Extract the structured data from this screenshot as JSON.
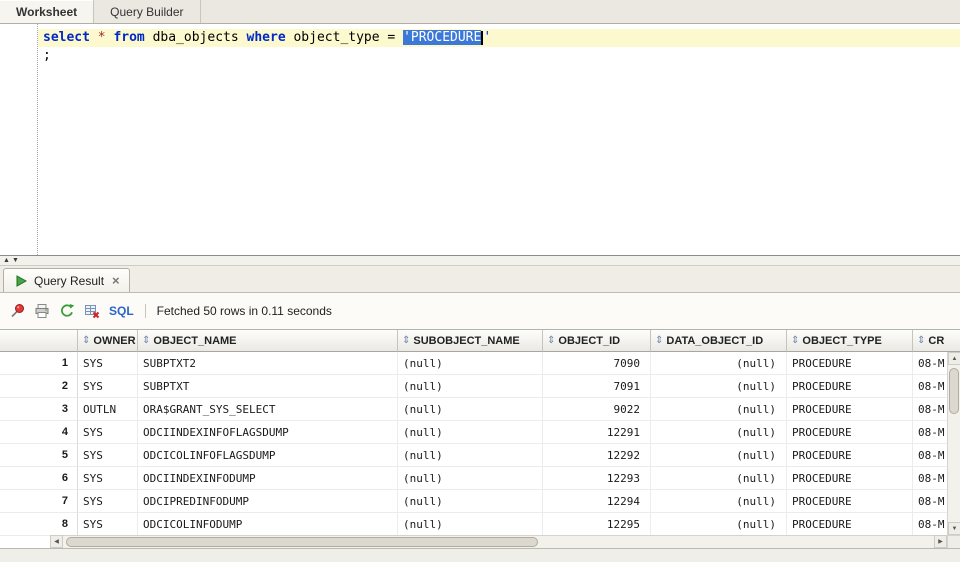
{
  "tabs": [
    {
      "label": "Worksheet"
    },
    {
      "label": "Query Builder"
    }
  ],
  "editor": {
    "lines": [
      {
        "tokens": [
          {
            "text": "select",
            "type": "kw"
          },
          {
            "text": " ",
            "type": "pl"
          },
          {
            "text": "*",
            "type": "op"
          },
          {
            "text": " ",
            "type": "pl"
          },
          {
            "text": "from",
            "type": "kw"
          },
          {
            "text": " dba_objects ",
            "type": "pl"
          },
          {
            "text": "where",
            "type": "kw"
          },
          {
            "text": " object_type = ",
            "type": "pl"
          },
          {
            "text": "'PROCEDURE",
            "type": "sel"
          },
          {
            "text": "'",
            "type": "str"
          }
        ]
      },
      {
        "tokens": [
          {
            "text": ";",
            "type": "pl"
          }
        ]
      }
    ]
  },
  "result_panel": {
    "tab_label": "Query Result",
    "tab_close": "×",
    "toolbar": {
      "sql_label": "SQL",
      "status": "Fetched 50 rows in 0.11 seconds"
    }
  },
  "icons": {
    "sort": "⇕",
    "splitter_up": "▲",
    "splitter_down": "▼",
    "scroll_up": "▲",
    "scroll_down": "▼",
    "scroll_left": "◀",
    "scroll_right": "▶"
  },
  "grid": {
    "columns": [
      {
        "label": "OWNER"
      },
      {
        "label": "OBJECT_NAME"
      },
      {
        "label": "SUBOBJECT_NAME"
      },
      {
        "label": "OBJECT_ID"
      },
      {
        "label": "DATA_OBJECT_ID"
      },
      {
        "label": "OBJECT_TYPE"
      },
      {
        "label": "CR"
      }
    ],
    "rows": [
      {
        "num": "1",
        "cells": [
          "SYS",
          "SUBPTXT2",
          "(null)",
          "7090",
          "(null)",
          "PROCEDURE",
          "08-M"
        ]
      },
      {
        "num": "2",
        "cells": [
          "SYS",
          "SUBPTXT",
          "(null)",
          "7091",
          "(null)",
          "PROCEDURE",
          "08-M"
        ]
      },
      {
        "num": "3",
        "cells": [
          "OUTLN",
          "ORA$GRANT_SYS_SELECT",
          "(null)",
          "9022",
          "(null)",
          "PROCEDURE",
          "08-M"
        ]
      },
      {
        "num": "4",
        "cells": [
          "SYS",
          "ODCIINDEXINFOFLAGSDUMP",
          "(null)",
          "12291",
          "(null)",
          "PROCEDURE",
          "08-M"
        ]
      },
      {
        "num": "5",
        "cells": [
          "SYS",
          "ODCICOLINFOFLAGSDUMP",
          "(null)",
          "12292",
          "(null)",
          "PROCEDURE",
          "08-M"
        ]
      },
      {
        "num": "6",
        "cells": [
          "SYS",
          "ODCIINDEXINFODUMP",
          "(null)",
          "12293",
          "(null)",
          "PROCEDURE",
          "08-M"
        ]
      },
      {
        "num": "7",
        "cells": [
          "SYS",
          "ODCIPREDINFODUMP",
          "(null)",
          "12294",
          "(null)",
          "PROCEDURE",
          "08-M"
        ]
      },
      {
        "num": "8",
        "cells": [
          "SYS",
          "ODCICOLINFODUMP",
          "(null)",
          "12295",
          "(null)",
          "PROCEDURE",
          "08-M"
        ]
      }
    ]
  }
}
